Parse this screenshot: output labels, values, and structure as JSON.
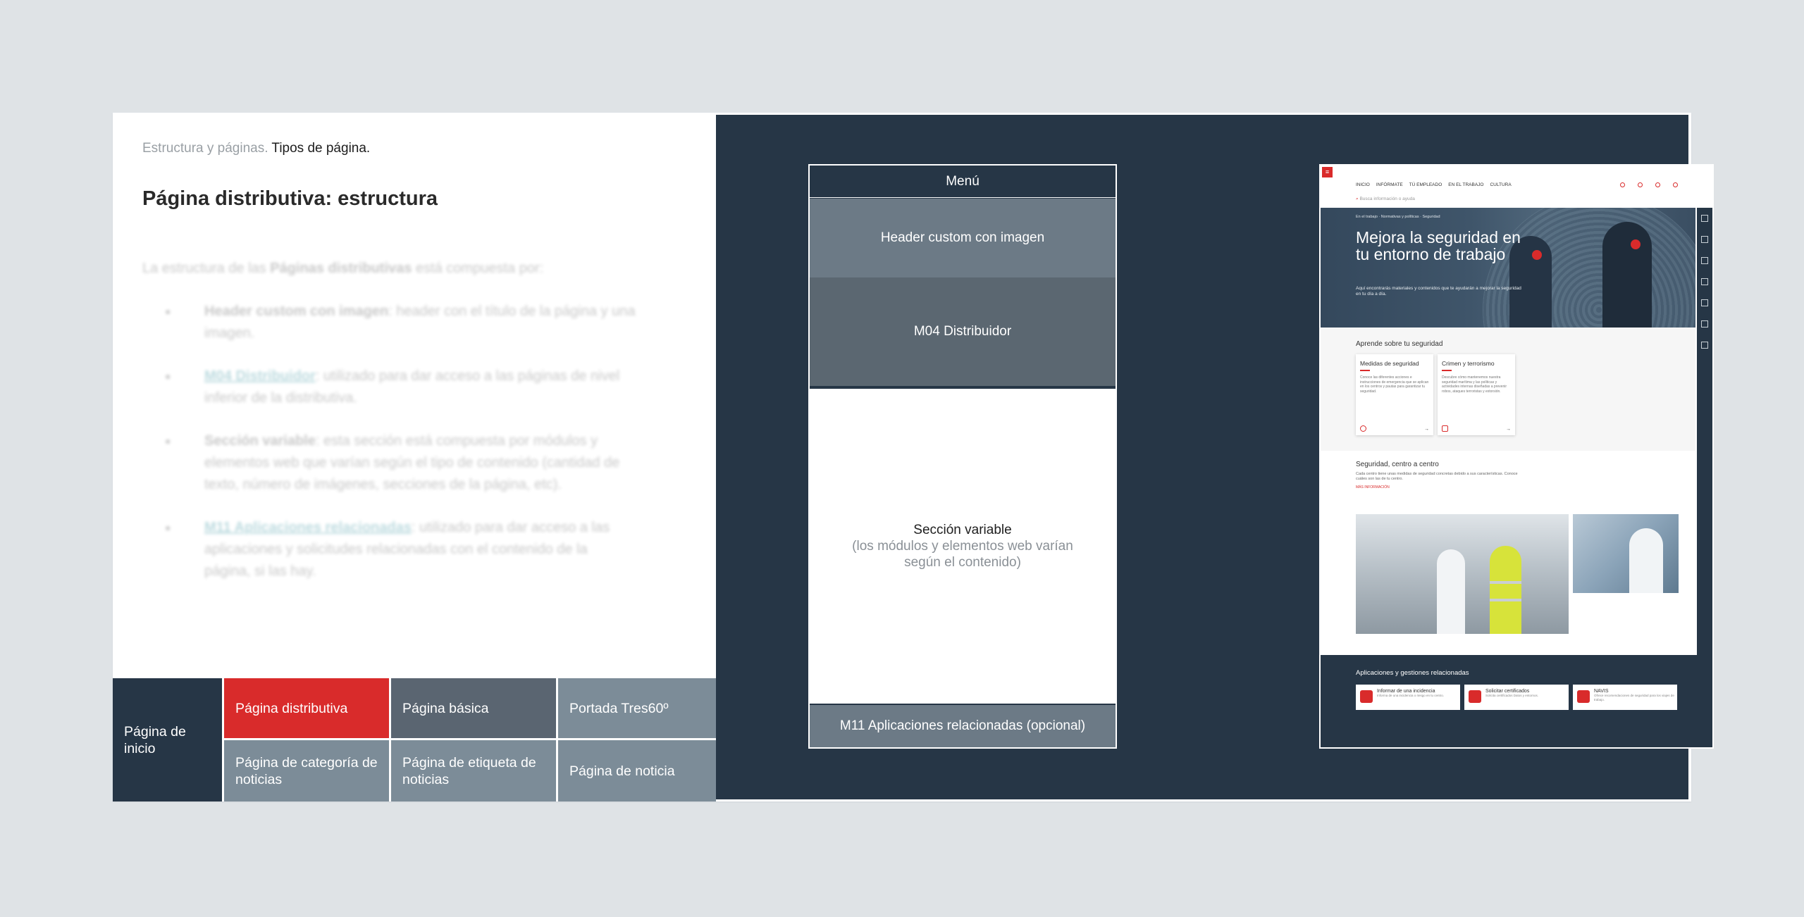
{
  "breadcrumb": {
    "section": "Estructura y páginas.",
    "current": "Tipos de página."
  },
  "title": "Página distributiva: estructura",
  "intro": {
    "pre": "La estructura de las ",
    "bold": "Páginas distributivas",
    "post": " está compuesta por:"
  },
  "bullets": [
    {
      "term": "Header custom con imagen",
      "text": ": header con el título de la página y una imagen."
    },
    {
      "term": "M04 Distribuidor",
      "text": ": utilizado para dar acceso a las páginas de nivel inferior de la distributiva."
    },
    {
      "term": "Sección variable",
      "text": ": esta sección está compuesta por módulos y elementos web que varían según el tipo de contenido (cantidad de texto, número de imágenes, secciones de la página, etc)."
    },
    {
      "term": "M11 Aplicaciones relacionadas",
      "text": ": utilizado para dar acceso a las aplicaciones y solicitudes relacionadas con el contenido de la página, si las hay."
    }
  ],
  "page_types": {
    "home": "Página de inicio",
    "distributive": "Página distributiva",
    "basic": "Página básica",
    "portada": "Portada Tres60º",
    "category": "Página de categoría de noticias",
    "tag": "Página de etiqueta de noticias",
    "news": "Página de noticia"
  },
  "wireframe": {
    "menu": "Menú",
    "header": "Header custom con imagen",
    "m04": "M04 Distribuidor",
    "variable_title": "Sección variable",
    "variable_desc": "(los módulos y elementos web varían según el contenido)",
    "m11": "M11 Aplicaciones relacionadas (opcional)"
  },
  "screenshot": {
    "nav": [
      "INICIO",
      "INFÓRMATE",
      "TÚ EMPLEADO",
      "EN EL TRABAJO",
      "CULTURA"
    ],
    "search_placeholder": "Busca información o ayuda",
    "breadcrumb": "En el trabajo · Normativas y políticas · Seguridad",
    "hero_title": "Mejora la seguridad en tu entorno de trabajo",
    "hero_desc": "Aquí encontrarás materiales y contenidos que te ayudarán a mejorar la seguridad en tu día a día.",
    "learn_title": "Aprende sobre tu seguridad",
    "cards": [
      {
        "title": "Medidas de seguridad",
        "desc": "Conoce las diferentes acciones e instrucciones de emergencia que se aplican en los centros y pautas para garantizar tu seguridad."
      },
      {
        "title": "Crimen y terrorismo",
        "desc": "Descubre cómo mantenemos nuestra seguridad marítima y las políticas y actividades internas diseñadas a prevenir robos, ataques terroristas y extorsión."
      }
    ],
    "center_title": "Seguridad, centro a centro",
    "center_desc": "Cada centro tiene unas medidas de seguridad concretas debido a sus características. Conoce cuáles son las de tu centro.",
    "center_link": "MÁS INFORMACIÓN",
    "apps_title": "Aplicaciones y gestiones relacionadas",
    "apps": [
      {
        "title": "Informar de una incidencia",
        "desc": "Informa de una incidencia o riesgo en tu centro."
      },
      {
        "title": "Solicitar certificados",
        "desc": "Solicita certificados Datos y entornos."
      },
      {
        "title": "NAVIS",
        "desc": "Ofrece recomendaciones de seguridad para los viajes de trabajo."
      }
    ]
  },
  "colors": {
    "navy": "#263646",
    "red": "#d92b2b",
    "slate": "#5a6571",
    "gray_blue": "#7c8c98"
  }
}
